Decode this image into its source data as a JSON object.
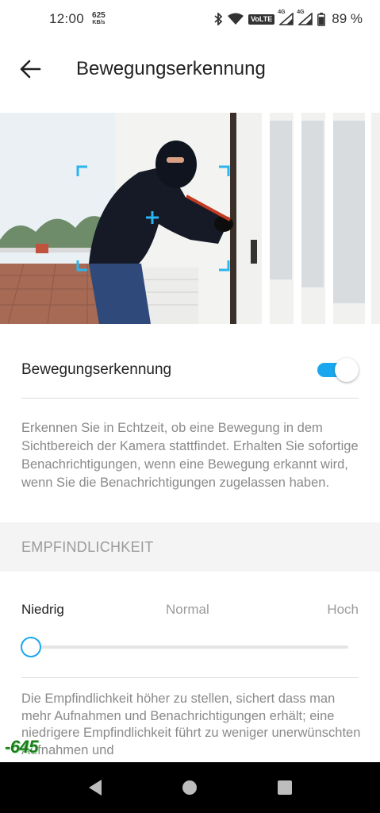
{
  "status_bar": {
    "time": "12:00",
    "net_speed_value": "625",
    "net_speed_unit": "KB/s",
    "volte": "VoLTE",
    "sim1_tag": "4G",
    "sim2_tag": "4G",
    "battery_percent": "89 %",
    "battery_level": 0.89
  },
  "header": {
    "title": "Bewegungserkennung"
  },
  "motion_toggle": {
    "label": "Bewegungserkennung",
    "enabled": true
  },
  "description": "Erkennen Sie in Echtzeit, ob eine Bewegung in dem Sichtbereich der Kamera stattfindet. Erhalten Sie sofortige Benachrichtigungen, wenn eine Bewegung erkannt wird, wenn Sie die Benachrichtigungen zugelassen haben.",
  "sensitivity": {
    "section_title": "EMPFINDLICHKEIT",
    "levels": [
      "Niedrig",
      "Normal",
      "Hoch"
    ],
    "selected": "Niedrig",
    "value": 0
  },
  "sensitivity_description": "Die Empfindlichkeit höher zu stellen, sichert dass man mehr Aufnahmen und Benachrichtigungen erhält; eine niedrigere Empfindlichkeit führt zu weniger unerwünschten Aufnahmen und",
  "overlay_number": "-645",
  "colors": {
    "accent": "#1aa7ee",
    "detection_frame": "#2bb5f0",
    "text_primary": "#222222",
    "text_secondary": "#8a8a8a",
    "section_band": "#f4f4f4",
    "nav_bar": "#000000"
  },
  "icons": {
    "back": "arrow-left-icon",
    "bluetooth": "bluetooth-icon",
    "wifi": "wifi-icon",
    "signal": "cell-signal-icon",
    "battery": "battery-icon",
    "nav_back": "triangle-back-icon",
    "nav_home": "circle-home-icon",
    "nav_recents": "square-recents-icon"
  }
}
